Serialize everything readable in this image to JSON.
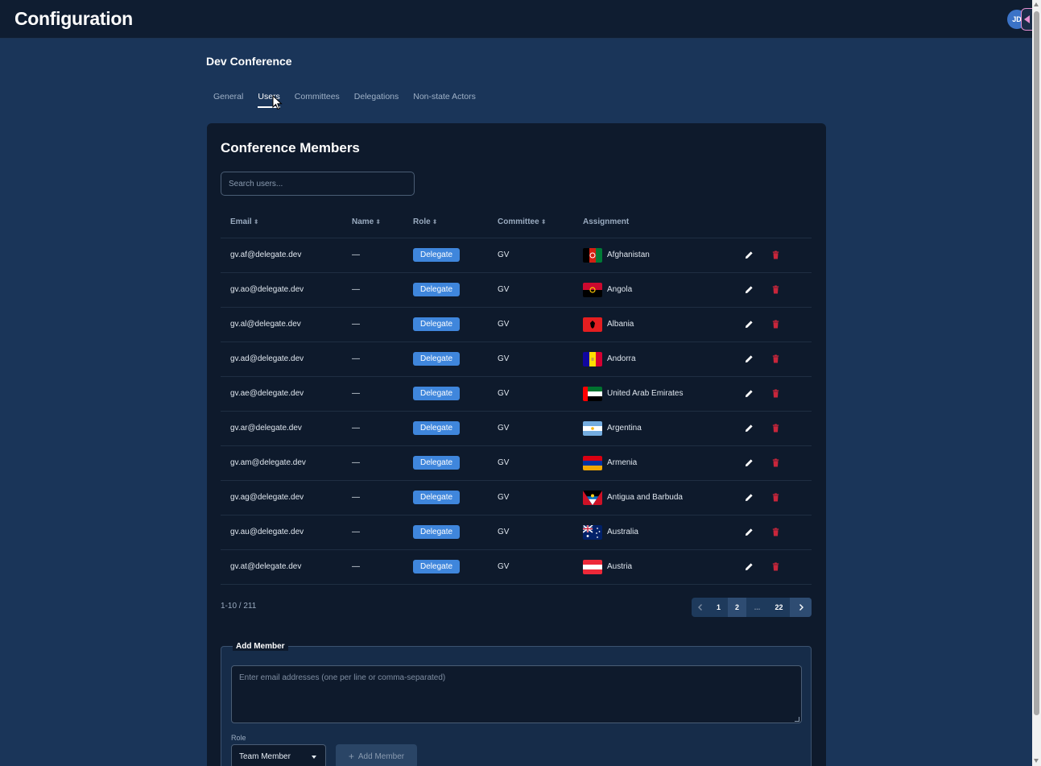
{
  "header": {
    "title": "Configuration",
    "avatar_initials": "JD"
  },
  "conference": {
    "name": "Dev Conference"
  },
  "tabs": [
    {
      "label": "General",
      "active": false
    },
    {
      "label": "Users",
      "active": true
    },
    {
      "label": "Committees",
      "active": false
    },
    {
      "label": "Delegations",
      "active": false
    },
    {
      "label": "Non-state Actors",
      "active": false
    }
  ],
  "members": {
    "title": "Conference Members",
    "search_placeholder": "Search users...",
    "columns": {
      "email": "Email",
      "name": "Name",
      "role": "Role",
      "committee": "Committee",
      "assignment": "Assignment"
    },
    "rows": [
      {
        "email": "gv.af@delegate.dev",
        "name": "—",
        "role": "Delegate",
        "committee": "GV",
        "assignment": "Afghanistan",
        "flag": "af"
      },
      {
        "email": "gv.ao@delegate.dev",
        "name": "—",
        "role": "Delegate",
        "committee": "GV",
        "assignment": "Angola",
        "flag": "ao"
      },
      {
        "email": "gv.al@delegate.dev",
        "name": "—",
        "role": "Delegate",
        "committee": "GV",
        "assignment": "Albania",
        "flag": "al"
      },
      {
        "email": "gv.ad@delegate.dev",
        "name": "—",
        "role": "Delegate",
        "committee": "GV",
        "assignment": "Andorra",
        "flag": "ad"
      },
      {
        "email": "gv.ae@delegate.dev",
        "name": "—",
        "role": "Delegate",
        "committee": "GV",
        "assignment": "United Arab Emirates",
        "flag": "ae"
      },
      {
        "email": "gv.ar@delegate.dev",
        "name": "—",
        "role": "Delegate",
        "committee": "GV",
        "assignment": "Argentina",
        "flag": "ar"
      },
      {
        "email": "gv.am@delegate.dev",
        "name": "—",
        "role": "Delegate",
        "committee": "GV",
        "assignment": "Armenia",
        "flag": "am"
      },
      {
        "email": "gv.ag@delegate.dev",
        "name": "—",
        "role": "Delegate",
        "committee": "GV",
        "assignment": "Antigua and Barbuda",
        "flag": "ag"
      },
      {
        "email": "gv.au@delegate.dev",
        "name": "—",
        "role": "Delegate",
        "committee": "GV",
        "assignment": "Australia",
        "flag": "au"
      },
      {
        "email": "gv.at@delegate.dev",
        "name": "—",
        "role": "Delegate",
        "committee": "GV",
        "assignment": "Austria",
        "flag": "at"
      }
    ],
    "range_text": "1-10 / 211",
    "pagination": {
      "pages": [
        "1",
        "2",
        "...",
        "22"
      ],
      "current": "2"
    }
  },
  "add_member": {
    "legend": "Add Member",
    "emails_placeholder": "Enter email addresses (one per line or comma-separated)",
    "role_label": "Role",
    "role_value": "Team Member",
    "button_label": "Add Member"
  },
  "colors": {
    "background": "#1a3559",
    "topbar": "#0f1d31",
    "card": "#0e1a2c",
    "accent": "#3f86dc",
    "delete": "#c8263b"
  }
}
